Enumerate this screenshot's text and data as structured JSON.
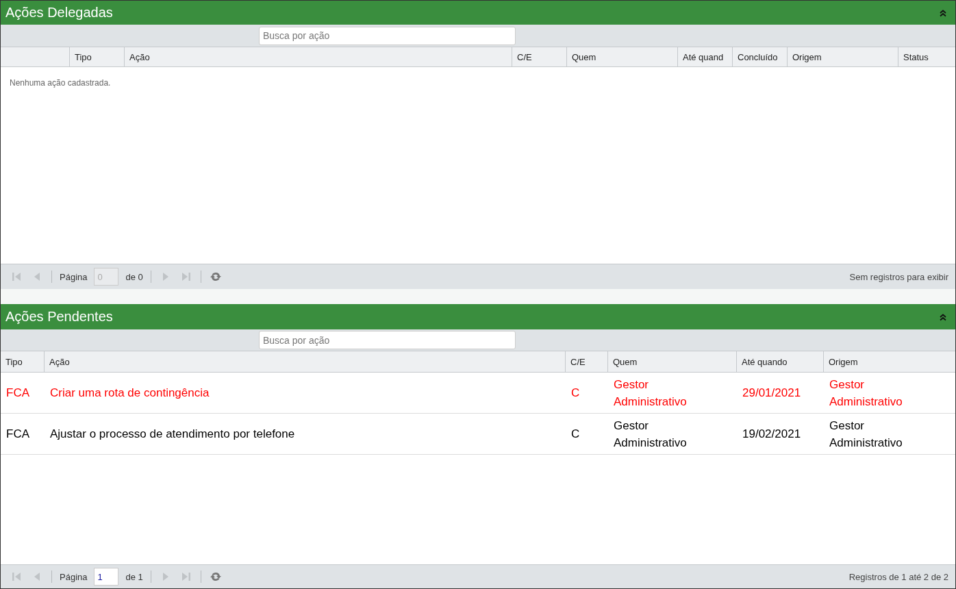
{
  "panels": [
    {
      "title": "Ações Delegadas",
      "search": {
        "placeholder": "Busca por ação"
      },
      "columns": [
        "",
        "Tipo",
        "Ação",
        "C/E",
        "Quem",
        "Até quand",
        "Concluído",
        "Origem",
        "Status"
      ],
      "empty_message": "Nenhuma ação cadastrada.",
      "pager": {
        "first_disabled": true,
        "prev_disabled": true,
        "page_label": "Página",
        "page_value": "0",
        "page_disabled": true,
        "of_label": "de 0",
        "next_disabled": true,
        "last_disabled": true,
        "summary": "Sem registros para exibir"
      }
    },
    {
      "title": "Ações Pendentes",
      "search": {
        "placeholder": "Busca por ação"
      },
      "columns": [
        "Tipo",
        "Ação",
        "C/E",
        "Quem",
        "Até quando",
        "Origem"
      ],
      "rows": [
        {
          "color": "#ff0000",
          "cells": [
            "FCA",
            "Criar uma rota de contingência",
            "C",
            "Gestor Administrativo",
            "29/01/2021",
            "Gestor Administrativo"
          ]
        },
        {
          "color": "#000000",
          "cells": [
            "FCA",
            "Ajustar o processo de atendimento por telefone",
            "C",
            "Gestor Administrativo",
            "19/02/2021",
            "Gestor Administrativo"
          ]
        }
      ],
      "pager": {
        "first_disabled": true,
        "prev_disabled": true,
        "page_label": "Página",
        "page_value": "1",
        "page_disabled": false,
        "of_label": "de 1",
        "next_disabled": true,
        "last_disabled": true,
        "summary": "Registros de 1 até 2 de 2"
      }
    }
  ]
}
